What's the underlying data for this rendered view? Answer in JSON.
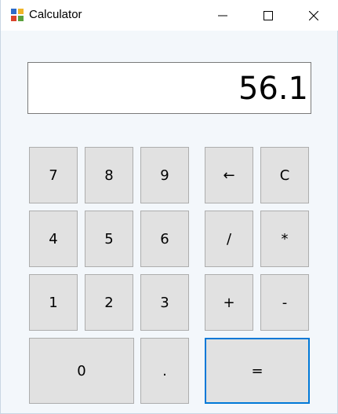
{
  "window": {
    "title": "Calculator",
    "icon": "calculator-app-icon",
    "controls": [
      "minimize-icon",
      "maximize-icon",
      "close-icon"
    ]
  },
  "display": {
    "value": "56.1"
  },
  "keys": {
    "k7": "7",
    "k8": "8",
    "k9": "9",
    "backspace": "←",
    "clear": "C",
    "k4": "4",
    "k5": "5",
    "k6": "6",
    "divide": "/",
    "multiply": "*",
    "k1": "1",
    "k2": "2",
    "k3": "3",
    "plus": "+",
    "minus": "-",
    "k0": "0",
    "dot": ".",
    "equals": "="
  },
  "colors": {
    "key_bg": "#e1e1e1",
    "key_border": "#adadad",
    "focus_border": "#0078d7",
    "window_bg": "#f3f7fb"
  }
}
